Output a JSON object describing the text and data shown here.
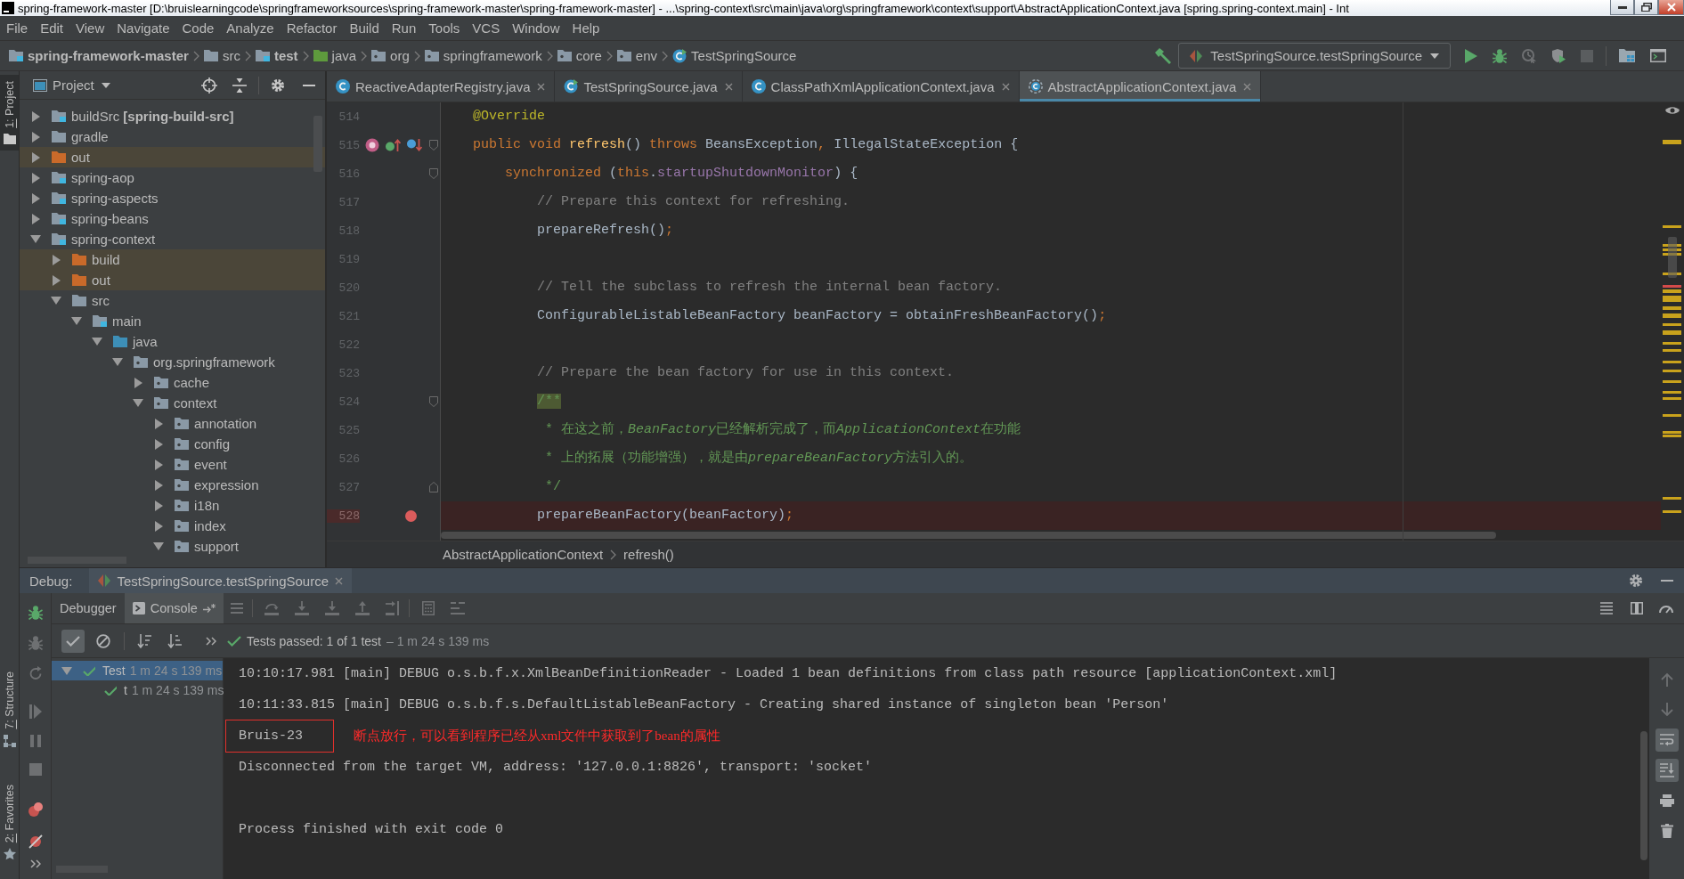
{
  "title_bar": {
    "title": "spring-framework-master [D:\\bruislearningcode\\springframeworksources\\spring-framework-master\\spring-framework-master] - ...\\spring-context\\src\\main\\java\\org\\springframework\\context\\support\\AbstractApplicationContext.java [spring.spring-context.main] - Int"
  },
  "menu_bar": {
    "items": [
      "File",
      "Edit",
      "View",
      "Navigate",
      "Code",
      "Analyze",
      "Refactor",
      "Build",
      "Run",
      "Tools",
      "VCS",
      "Window",
      "Help"
    ]
  },
  "navigation_bar": {
    "crumbs": [
      {
        "label": "spring-framework-master",
        "kind": "module"
      },
      {
        "label": "src",
        "kind": "folder"
      },
      {
        "label": "test",
        "kind": "module"
      },
      {
        "label": "java",
        "kind": "test-root"
      },
      {
        "label": "org",
        "kind": "package"
      },
      {
        "label": "springframework",
        "kind": "package"
      },
      {
        "label": "core",
        "kind": "package"
      },
      {
        "label": "env",
        "kind": "package"
      },
      {
        "label": "TestSpringSource",
        "kind": "test-class"
      }
    ],
    "run_configuration": "TestSpringSource.testSpringSource"
  },
  "tool_stripe": {
    "top": [
      {
        "label": "1: Project",
        "selected": true
      }
    ],
    "bottom": [
      {
        "label": "7: Structure",
        "selected": false
      },
      {
        "label": "2: Favorites",
        "selected": false
      }
    ]
  },
  "project_panel": {
    "title": "Project",
    "tree": [
      {
        "label": "buildSrc **[spring-build-src]**",
        "kind": "module",
        "expanded": false
      },
      {
        "label": "gradle",
        "kind": "folder",
        "expanded": false
      },
      {
        "label": "out",
        "kind": "excluded",
        "expanded": false
      },
      {
        "label": "spring-aop",
        "kind": "module",
        "expanded": false
      },
      {
        "label": "spring-aspects",
        "kind": "module",
        "expanded": false
      },
      {
        "label": "spring-beans",
        "kind": "module",
        "expanded": false
      },
      {
        "label": "spring-context",
        "kind": "module",
        "expanded": true,
        "children": [
          {
            "label": "build",
            "kind": "excluded",
            "expanded": false
          },
          {
            "label": "out",
            "kind": "excluded",
            "expanded": false
          },
          {
            "label": "src",
            "kind": "folder",
            "expanded": true,
            "children": [
              {
                "label": "main",
                "kind": "module",
                "expanded": true,
                "children": [
                  {
                    "label": "java",
                    "kind": "source-root",
                    "expanded": true,
                    "children": [
                      {
                        "label": "org.springframework",
                        "kind": "package",
                        "expanded": true,
                        "children": [
                          {
                            "label": "cache",
                            "kind": "package",
                            "expanded": false
                          },
                          {
                            "label": "context",
                            "kind": "package",
                            "expanded": true,
                            "children": [
                              {
                                "label": "annotation",
                                "kind": "package",
                                "expanded": false
                              },
                              {
                                "label": "config",
                                "kind": "package",
                                "expanded": false
                              },
                              {
                                "label": "event",
                                "kind": "package",
                                "expanded": false
                              },
                              {
                                "label": "expression",
                                "kind": "package",
                                "expanded": false
                              },
                              {
                                "label": "i18n",
                                "kind": "package",
                                "expanded": false
                              },
                              {
                                "label": "index",
                                "kind": "package",
                                "expanded": false
                              },
                              {
                                "label": "support",
                                "kind": "package",
                                "expanded": true
                              }
                            ]
                          }
                        ]
                      }
                    ]
                  }
                ]
              }
            ]
          }
        ]
      }
    ]
  },
  "editor": {
    "tabs": [
      {
        "label": "ReactiveAdapterRegistry.java",
        "kind": "class",
        "selected": false
      },
      {
        "label": "TestSpringSource.java",
        "kind": "test-class",
        "selected": false
      },
      {
        "label": "ClassPathXmlApplicationContext.java",
        "kind": "class",
        "selected": false
      },
      {
        "label": "AbstractApplicationContext.java",
        "kind": "abstract-class",
        "selected": true
      }
    ],
    "lines": [
      {
        "number": "514",
        "breakpoint": false,
        "tokens": [
          {
            "text": "    @Override",
            "kind": "annotation"
          }
        ]
      },
      {
        "number": "515",
        "breakpoint": false,
        "gutter": [
          {
            "kind": "method"
          },
          {
            "kind": "implements"
          },
          {
            "kind": "overridden"
          }
        ],
        "fold": {
          "kind": "start"
        },
        "tokens": [
          {
            "text": "    public void ",
            "kind": "keyword"
          },
          {
            "text": "refresh",
            "kind": "method"
          },
          {
            "text": "() ",
            "kind": "plain"
          },
          {
            "text": "throws ",
            "kind": "keyword"
          },
          {
            "text": "BeansException",
            "kind": "plain"
          },
          {
            "text": ", ",
            "kind": "punct"
          },
          {
            "text": "IllegalStateException {",
            "kind": "plain"
          }
        ]
      },
      {
        "number": "516",
        "breakpoint": false,
        "fold": {
          "kind": "start"
        },
        "tokens": [
          {
            "text": "        synchronized ",
            "kind": "keyword"
          },
          {
            "text": "(",
            "kind": "plain"
          },
          {
            "text": "this",
            "kind": "keyword"
          },
          {
            "text": ".",
            "kind": "plain"
          },
          {
            "text": "startupShutdownMonitor",
            "kind": "field"
          },
          {
            "text": ") {",
            "kind": "plain"
          }
        ]
      },
      {
        "number": "517",
        "breakpoint": false,
        "tokens": [
          {
            "text": "            // Prepare this context for refreshing.",
            "kind": "comment"
          }
        ]
      },
      {
        "number": "518",
        "breakpoint": false,
        "tokens": [
          {
            "text": "            prepareRefresh()",
            "kind": "plain"
          },
          {
            "text": ";",
            "kind": "punct"
          }
        ]
      },
      {
        "number": "519",
        "breakpoint": false
      },
      {
        "number": "520",
        "breakpoint": false,
        "tokens": [
          {
            "text": "            // Tell the subclass to refresh the internal bean factory.",
            "kind": "comment"
          }
        ]
      },
      {
        "number": "521",
        "breakpoint": false,
        "tokens": [
          {
            "text": "            ConfigurableListableBeanFactory beanFactory = obtainFreshBeanFactory()",
            "kind": "plain"
          },
          {
            "text": ";",
            "kind": "punct"
          }
        ]
      },
      {
        "number": "522",
        "breakpoint": false
      },
      {
        "number": "523",
        "breakpoint": false,
        "tokens": [
          {
            "text": "            // Prepare the bean factory for use in this context.",
            "kind": "comment"
          }
        ]
      },
      {
        "number": "524",
        "breakpoint": false,
        "fold": {
          "kind": "start"
        },
        "tokens": [
          {
            "text": "            /**",
            "kind": "doc-highlighted"
          }
        ]
      },
      {
        "number": "525",
        "breakpoint": false,
        "tokens": [
          {
            "text": "             * 在这之前，",
            "kind": "doc"
          },
          {
            "text": "BeanFactory",
            "kind": "doc-code"
          },
          {
            "text": "已经解析完成了，而",
            "kind": "doc"
          },
          {
            "text": "ApplicationContext",
            "kind": "doc-code"
          },
          {
            "text": "在功能",
            "kind": "doc"
          }
        ]
      },
      {
        "number": "526",
        "breakpoint": false,
        "tokens": [
          {
            "text": "             * 上的拓展（功能增强），就是由",
            "kind": "doc"
          },
          {
            "text": "prepareBeanFactory",
            "kind": "doc-code"
          },
          {
            "text": "方法引入的。",
            "kind": "doc"
          }
        ]
      },
      {
        "number": "527",
        "breakpoint": false,
        "fold": {
          "kind": "end"
        },
        "tokens": [
          {
            "text": "             */",
            "kind": "doc"
          }
        ]
      },
      {
        "number": "528",
        "breakpoint": true,
        "tokens": [
          {
            "text": "            prepareBeanFactory(beanFactory)",
            "kind": "plain"
          },
          {
            "text": ";",
            "kind": "punct"
          }
        ]
      }
    ],
    "breadcrumbs": [
      "AbstractApplicationContext",
      "refresh()"
    ]
  },
  "debug_panel": {
    "title": "Debug:",
    "session": "TestSpringSource.testSpringSource",
    "tabs": [
      {
        "label": "Debugger",
        "selected": false
      },
      {
        "label": "Console",
        "selected": true
      }
    ],
    "show_passed": true,
    "show_ignored": false,
    "status": "Tests passed: 1 of 1 test",
    "duration": "– 1 m 24 s 139 ms",
    "tests": [
      {
        "label": "Test",
        "duration": "1 m 24 s 139 ms",
        "passed": true,
        "expanded": true,
        "selected": true,
        "children": [
          {
            "label": "t",
            "duration": "1 m 24 s 139 ms",
            "passed": true,
            "selected": false
          }
        ]
      }
    ],
    "console": {
      "lines": [
        {
          "text": "10:10:17.981 [main] DEBUG o.s.b.f.x.XmlBeanDefinitionReader - Loaded 1 bean definitions from class path resource [applicationContext.xml]",
          "kind": "log",
          "boxed": false
        },
        {
          "text": "10:11:33.815 [main] DEBUG o.s.b.f.s.DefaultListableBeanFactory - Creating shared instance of singleton bean 'Person'",
          "kind": "log",
          "boxed": false
        },
        {
          "text": "Bruis-23",
          "kind": "output",
          "boxed": true,
          "note": "断点放行，可以看到程序已经从xml文件中获取到了bean的属性"
        },
        {
          "text": "Disconnected from the target VM, address: '127.0.0.1:8826', transport: 'socket'",
          "kind": "system",
          "boxed": false
        },
        {
          "text": "Process finished with exit code 0",
          "kind": "exit",
          "boxed": false
        }
      ]
    },
    "soft_wrap": true,
    "scroll_to_end": true
  }
}
